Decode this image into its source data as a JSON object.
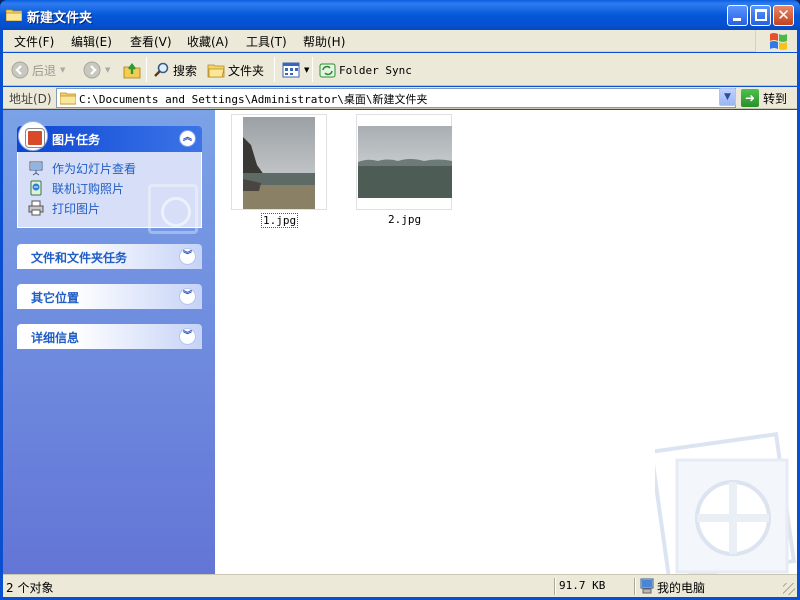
{
  "window": {
    "title": "新建文件夹"
  },
  "menu": [
    "文件(F)",
    "编辑(E)",
    "查看(V)",
    "收藏(A)",
    "工具(T)",
    "帮助(H)"
  ],
  "toolbar": {
    "back": "后退",
    "search": "搜索",
    "folders": "文件夹",
    "folder_sync": "Folder Sync"
  },
  "address": {
    "label": "地址(D)",
    "path": "C:\\Documents and Settings\\Administrator\\桌面\\新建文件夹",
    "go": "转到"
  },
  "taskpane": {
    "picture_tasks": {
      "title": "图片任务",
      "items": [
        "作为幻灯片查看",
        "联机订购照片",
        "打印图片"
      ]
    },
    "file_tasks": "文件和文件夹任务",
    "other_places": "其它位置",
    "details": "详细信息"
  },
  "files": [
    {
      "name": "1.jpg",
      "selected": true
    },
    {
      "name": "2.jpg",
      "selected": false
    }
  ],
  "status": {
    "objects": "2 个对象",
    "size": "91.7 KB",
    "location": "我的电脑"
  },
  "colors": {
    "titlebar": "#0558d8",
    "taskpane": "#6f8ede",
    "link": "#215dc6"
  }
}
